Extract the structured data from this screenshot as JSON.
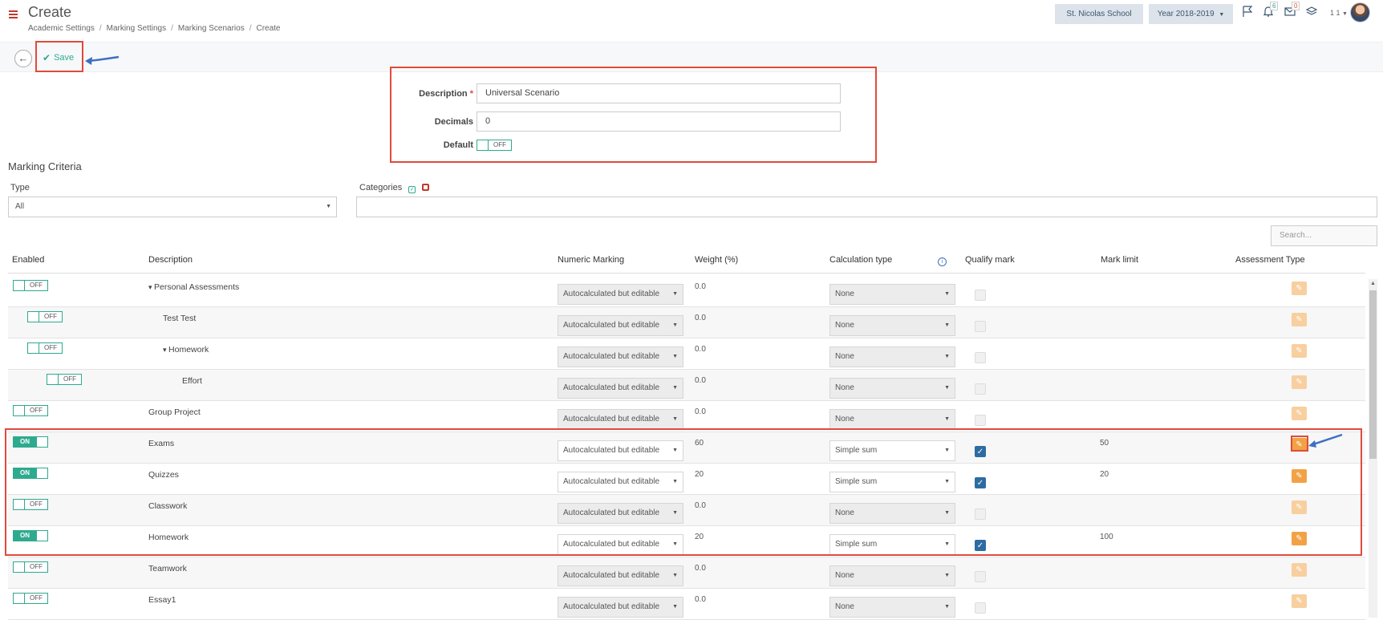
{
  "header": {
    "title": "Create",
    "breadcrumb": [
      "Academic Settings",
      "Marking Settings",
      "Marking Scenarios",
      "Create"
    ],
    "school": "St. Nicolas School",
    "year": "Year 2018-2019",
    "notification_count": "6",
    "message_count": "0",
    "user_label": "1 1"
  },
  "toolbar": {
    "save_label": "Save"
  },
  "form": {
    "description_label": "Description",
    "description_value": "Universal Scenario",
    "decimals_label": "Decimals",
    "decimals_value": "0",
    "default_label": "Default",
    "default_toggle": "OFF"
  },
  "criteria": {
    "title": "Marking Criteria",
    "type_label": "Type",
    "type_value": "All",
    "categories_label": "Categories",
    "search_placeholder": "Search...",
    "columns": [
      "Enabled",
      "Description",
      "Numeric Marking",
      "Weight (%)",
      "Calculation type",
      "Qualify mark",
      "Mark limit",
      "Assessment Type"
    ],
    "rows": [
      {
        "enabled": "OFF",
        "on": false,
        "level": 0,
        "expand": true,
        "description": "Personal Assessments",
        "numeric": "Autocalculated but editable",
        "weight": "0.0",
        "calc": "None",
        "qualify": false,
        "mark_limit": ""
      },
      {
        "enabled": "OFF",
        "on": false,
        "level": 1,
        "expand": false,
        "description": "Test Test",
        "numeric": "Autocalculated but editable",
        "weight": "0.0",
        "calc": "None",
        "qualify": false,
        "mark_limit": ""
      },
      {
        "enabled": "OFF",
        "on": false,
        "level": 1,
        "expand": true,
        "description": "Homework",
        "numeric": "Autocalculated but editable",
        "weight": "0.0",
        "calc": "None",
        "qualify": false,
        "mark_limit": ""
      },
      {
        "enabled": "OFF",
        "on": false,
        "level": 2,
        "expand": false,
        "description": "Effort",
        "numeric": "Autocalculated but editable",
        "weight": "0.0",
        "calc": "None",
        "qualify": false,
        "mark_limit": ""
      },
      {
        "enabled": "OFF",
        "on": false,
        "level": 0,
        "expand": false,
        "description": "Group Project",
        "numeric": "Autocalculated but editable",
        "weight": "0.0",
        "calc": "None",
        "qualify": false,
        "mark_limit": ""
      },
      {
        "enabled": "ON",
        "on": true,
        "level": 0,
        "expand": false,
        "description": "Exams",
        "numeric": "Autocalculated but editable",
        "weight": "60",
        "calc": "Simple sum",
        "qualify": true,
        "mark_limit": "50"
      },
      {
        "enabled": "ON",
        "on": true,
        "level": 0,
        "expand": false,
        "description": "Quizzes",
        "numeric": "Autocalculated but editable",
        "weight": "20",
        "calc": "Simple sum",
        "qualify": true,
        "mark_limit": "20"
      },
      {
        "enabled": "OFF",
        "on": false,
        "level": 0,
        "expand": false,
        "description": "Classwork",
        "numeric": "Autocalculated but editable",
        "weight": "0.0",
        "calc": "None",
        "qualify": false,
        "mark_limit": ""
      },
      {
        "enabled": "ON",
        "on": true,
        "level": 0,
        "expand": false,
        "description": "Homework",
        "numeric": "Autocalculated but editable",
        "weight": "20",
        "calc": "Simple sum",
        "qualify": true,
        "mark_limit": "100"
      },
      {
        "enabled": "OFF",
        "on": false,
        "level": 0,
        "expand": false,
        "description": "Teamwork",
        "numeric": "Autocalculated but editable",
        "weight": "0.0",
        "calc": "None",
        "qualify": false,
        "mark_limit": ""
      },
      {
        "enabled": "OFF",
        "on": false,
        "level": 0,
        "expand": false,
        "description": "Essay1",
        "numeric": "Autocalculated but editable",
        "weight": "0.0",
        "calc": "None",
        "qualify": false,
        "mark_limit": ""
      }
    ]
  },
  "colors": {
    "accent": "#2eaa8e",
    "highlight_red": "#e04a3c",
    "arrow_blue": "#3f6fc2",
    "edit_orange": "#f2a245"
  }
}
